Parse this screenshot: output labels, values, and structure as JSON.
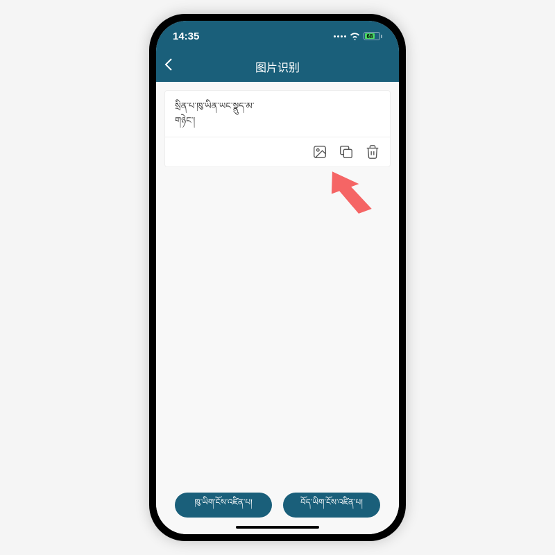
{
  "statusBar": {
    "time": "14:35",
    "batteryText": "68"
  },
  "header": {
    "title": "图片识别"
  },
  "card": {
    "line1": "སྲིན་པ་ཁུ་ཡིན་ཡང་སྣུད་མ་",
    "line2": "གཉེང་།"
  },
  "footer": {
    "btn1": "ཁུ་ཡིག་ངོས་འཛིན་པ།",
    "btn2": "བོད་ཡིག་ངོས་འཛིན་པ།"
  },
  "icons": {
    "image": "image-icon",
    "copy": "copy-icon",
    "delete": "trash-icon"
  }
}
